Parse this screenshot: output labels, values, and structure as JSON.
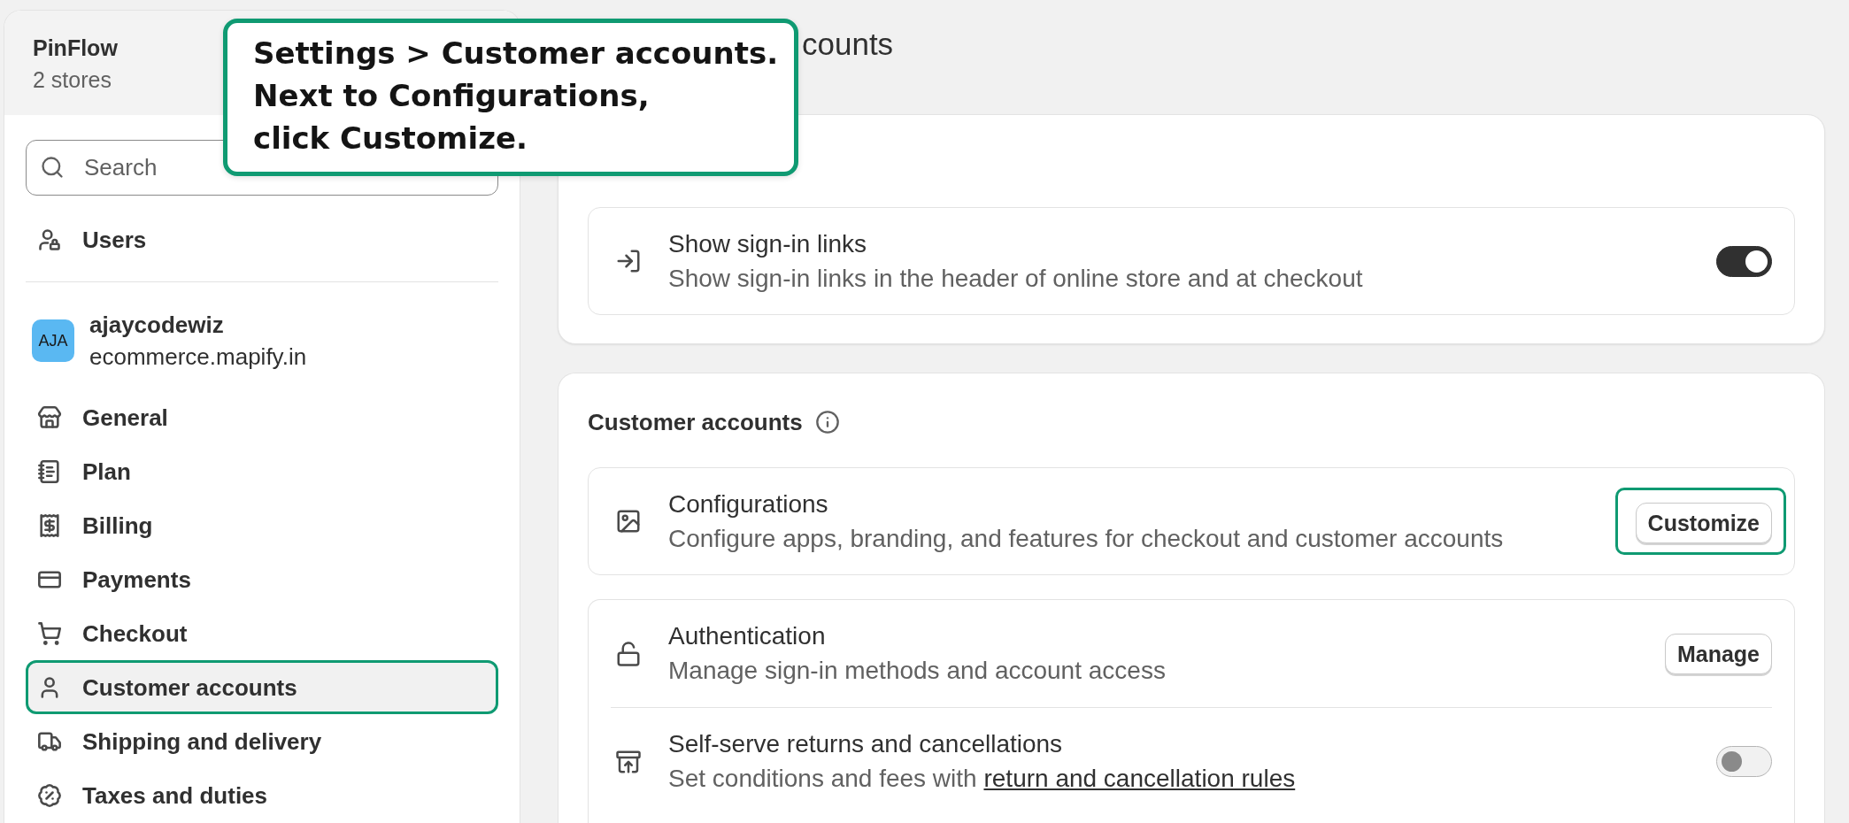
{
  "callout": {
    "lines": [
      "Settings > Customer accounts.",
      "Next to Configurations,",
      "click Customize."
    ]
  },
  "sidebar": {
    "org": {
      "name": "PinFlow",
      "subtitle": "2 stores"
    },
    "search": {
      "placeholder": "Search"
    },
    "top_items": [
      {
        "label": "Users",
        "selected": false,
        "highlighted": false
      }
    ],
    "store": {
      "initials": "AJA",
      "name": "ajaycodewiz",
      "domain": "ecommerce.mapify.in"
    },
    "items": [
      {
        "label": "General",
        "selected": false,
        "highlighted": false
      },
      {
        "label": "Plan",
        "selected": false,
        "highlighted": false
      },
      {
        "label": "Billing",
        "selected": false,
        "highlighted": false
      },
      {
        "label": "Payments",
        "selected": false,
        "highlighted": false
      },
      {
        "label": "Checkout",
        "selected": false,
        "highlighted": false
      },
      {
        "label": "Customer accounts",
        "selected": true,
        "highlighted": true
      },
      {
        "label": "Shipping and delivery",
        "selected": false,
        "highlighted": false
      },
      {
        "label": "Taxes and duties",
        "selected": false,
        "highlighted": false
      }
    ]
  },
  "page": {
    "title": "counts"
  },
  "sign_in_card": {
    "groups": [
      [
        {
          "kind": "toggle",
          "title": "Show sign-in links",
          "description": "Show sign-in links in the header of online store and at checkout",
          "on": true
        }
      ]
    ]
  },
  "customer_accounts_card": {
    "heading": "Customer accounts",
    "groups": [
      [
        {
          "kind": "button",
          "title": "Configurations",
          "description": "Configure apps, branding, and features for checkout and customer accounts",
          "button": "Customize",
          "highlighted": true
        }
      ],
      [
        {
          "kind": "button",
          "title": "Authentication",
          "description": "Manage sign-in methods and account access",
          "button": "Manage",
          "highlighted": false
        },
        {
          "kind": "toggle",
          "title": "Self-serve returns and cancellations",
          "description": "Set conditions and fees with",
          "link": "return and cancellation rules",
          "on": false
        }
      ]
    ]
  }
}
